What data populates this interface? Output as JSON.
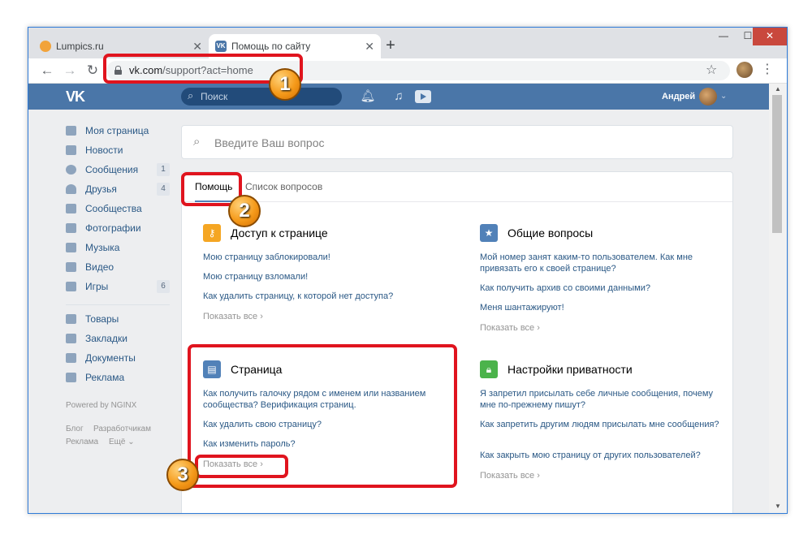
{
  "browser": {
    "tabs": [
      {
        "title": "Lumpics.ru",
        "close": "✕"
      },
      {
        "title": "Помощь по сайту",
        "close": "✕"
      }
    ],
    "new_tab": "+",
    "url_host": "vk.com",
    "url_path": "/support?act=home"
  },
  "vk_header": {
    "logo": "VK",
    "search_placeholder": "Поиск",
    "user_name": "Андрей"
  },
  "sidebar": {
    "items": [
      {
        "label": "Моя страница",
        "count": ""
      },
      {
        "label": "Новости",
        "count": ""
      },
      {
        "label": "Сообщения",
        "count": "1"
      },
      {
        "label": "Друзья",
        "count": "4"
      },
      {
        "label": "Сообщества",
        "count": ""
      },
      {
        "label": "Фотографии",
        "count": ""
      },
      {
        "label": "Музыка",
        "count": ""
      },
      {
        "label": "Видео",
        "count": ""
      },
      {
        "label": "Игры",
        "count": "6"
      },
      {
        "label": "Товары",
        "count": ""
      },
      {
        "label": "Закладки",
        "count": ""
      },
      {
        "label": "Документы",
        "count": ""
      },
      {
        "label": "Реклама",
        "count": ""
      }
    ],
    "powered": "Powered by NGINX",
    "footer": [
      "Блог",
      "Разработчикам",
      "Реклама",
      "Ещё ⌄"
    ]
  },
  "main": {
    "question_placeholder": "Введите Ваш вопрос",
    "tabs": [
      "Помощь",
      "Список вопросов"
    ],
    "show_all": "Показать все ›",
    "sections": [
      {
        "title": "Доступ к странице",
        "icon": "key-icon",
        "color": "#f5a623",
        "links": [
          "Мою страницу заблокировали!",
          "Мою страницу взломали!",
          "Как удалить страницу, к которой нет доступа?"
        ]
      },
      {
        "title": "Общие вопросы",
        "icon": "star-icon",
        "color": "#5181b8",
        "links": [
          "Мой номер занят каким-то пользователем. Как мне привязать его к своей странице?",
          "Как получить архив со своими данными?",
          "Меня шантажируют!"
        ]
      },
      {
        "title": "Страница",
        "icon": "profile-card-icon",
        "color": "#5181b8",
        "links": [
          "Как получить галочку рядом с именем или названием сообщества? Верификация страниц.",
          "Как удалить свою страницу?",
          "Как изменить пароль?"
        ]
      },
      {
        "title": "Настройки приватности",
        "icon": "lock-icon",
        "color": "#4bb34b",
        "links": [
          "Я запретил присылать себе личные сообщения, почему мне по-прежнему пишут?",
          "Как запретить другим людям присылать мне сообщения?",
          "Как закрыть мою страницу от других пользователей?"
        ]
      }
    ]
  },
  "annotations": [
    "1",
    "2",
    "3"
  ],
  "colors": {
    "accent": "#4a76a8",
    "link": "#2a5885",
    "highlight": "#e0141e"
  }
}
